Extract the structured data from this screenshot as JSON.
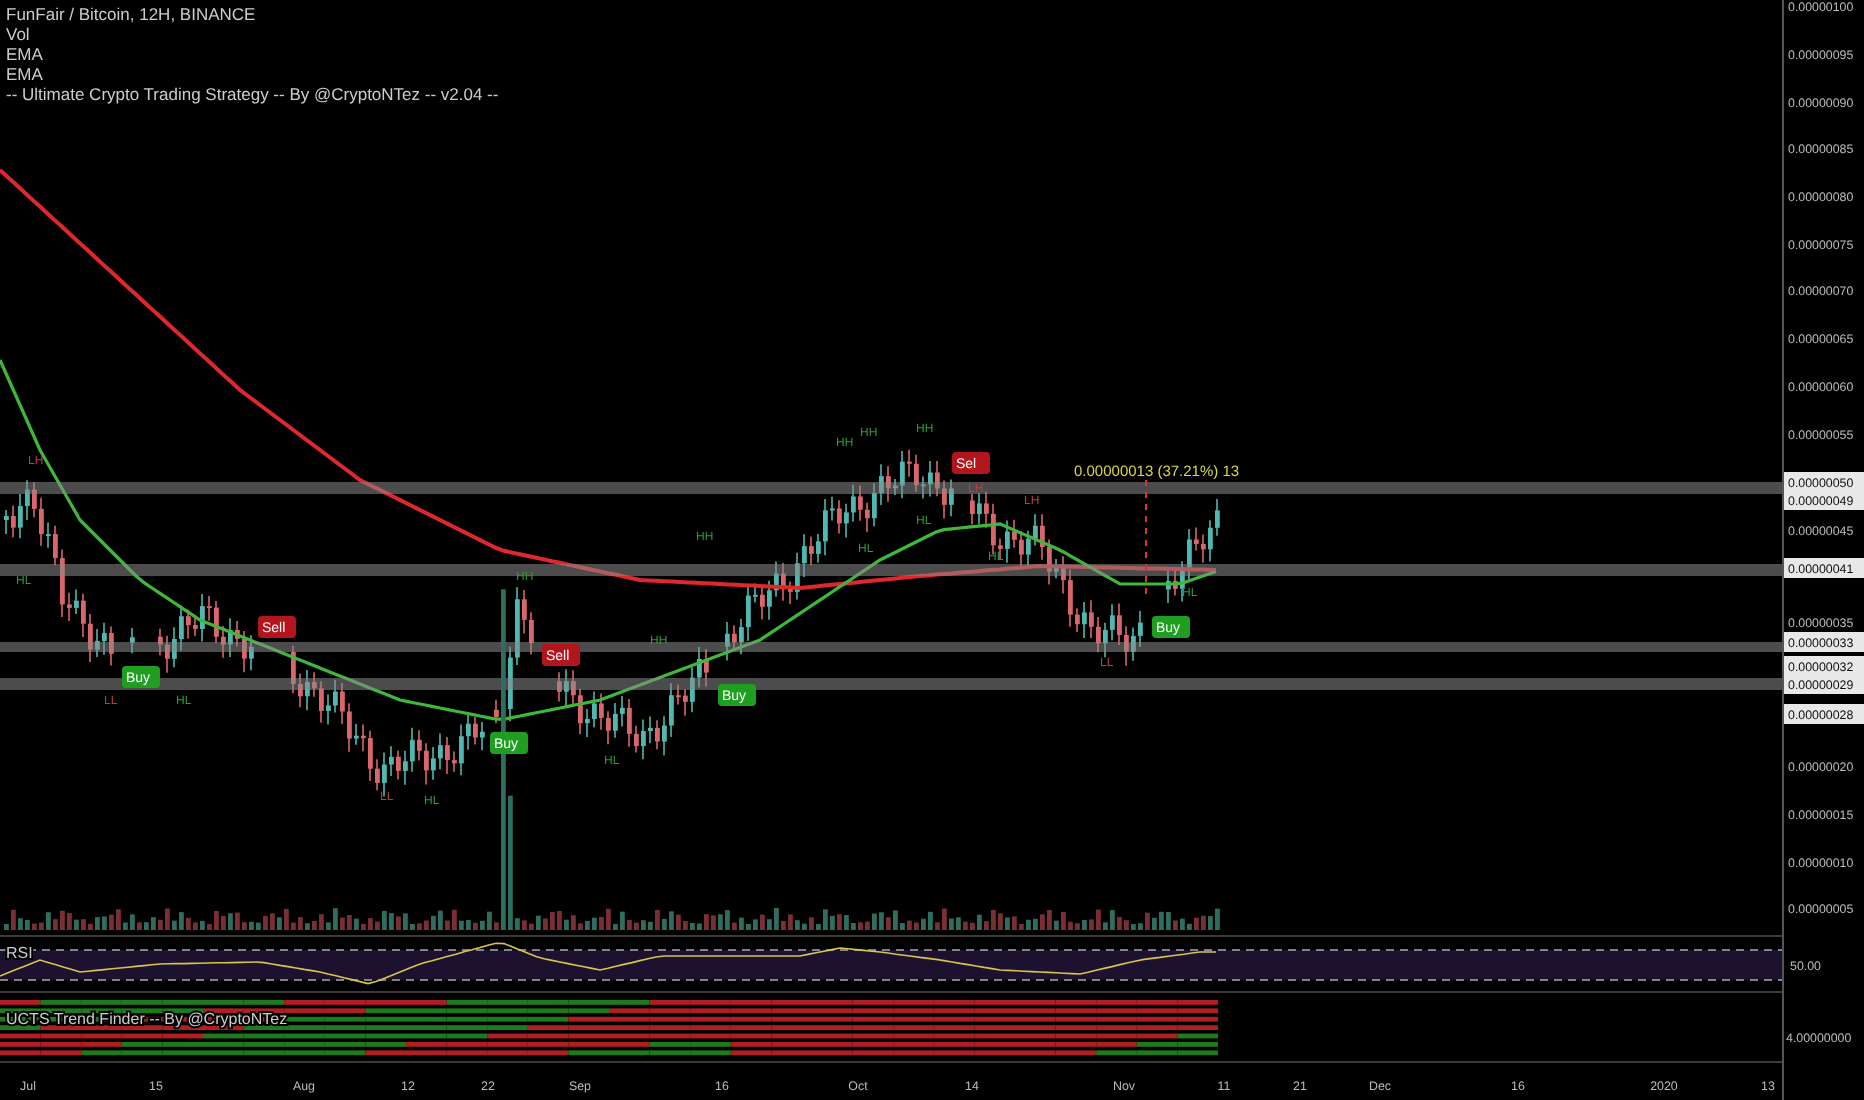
{
  "header": {
    "symbol": "FunFair / Bitcoin, 12H, BINANCE",
    "indicators": [
      "Vol",
      "EMA",
      "EMA",
      "-- Ultimate Crypto Trading Strategy -- By @CryptoNTez -- v2.04 --"
    ]
  },
  "chart": {
    "measure": "0.00000013 (37.21%) 13",
    "signals": [
      {
        "label": "Buy",
        "kind": "buy"
      },
      {
        "label": "Sell",
        "kind": "sell"
      },
      {
        "label": "Buy",
        "kind": "buy"
      },
      {
        "label": "Sell",
        "kind": "sell"
      },
      {
        "label": "Buy",
        "kind": "buy"
      },
      {
        "label": "Sel",
        "kind": "sell"
      },
      {
        "label": "Buy",
        "kind": "buy"
      }
    ],
    "pivots": [
      {
        "label": "LH",
        "kind": "low"
      },
      {
        "label": "HL",
        "kind": "high"
      },
      {
        "label": "LL",
        "kind": "low"
      },
      {
        "label": "HL",
        "kind": "high"
      },
      {
        "label": "LL",
        "kind": "low"
      },
      {
        "label": "HL",
        "kind": "high"
      },
      {
        "label": "HH",
        "kind": "high"
      },
      {
        "label": "HL",
        "kind": "high"
      },
      {
        "label": "HH",
        "kind": "high"
      },
      {
        "label": "HH",
        "kind": "high"
      },
      {
        "label": "HH",
        "kind": "high"
      },
      {
        "label": "HH",
        "kind": "high"
      },
      {
        "label": "HH",
        "kind": "high"
      },
      {
        "label": "HL",
        "kind": "high"
      },
      {
        "label": "HL",
        "kind": "high"
      },
      {
        "label": "LH",
        "kind": "low"
      },
      {
        "label": "HL",
        "kind": "high"
      },
      {
        "label": "LH",
        "kind": "low"
      },
      {
        "label": "LL",
        "kind": "low"
      },
      {
        "label": "HL",
        "kind": "high"
      }
    ]
  },
  "price_axis": [
    {
      "label": "0.00000100",
      "kind": "tick"
    },
    {
      "label": "0.00000095",
      "kind": "tick"
    },
    {
      "label": "0.00000090",
      "kind": "tick"
    },
    {
      "label": "0.00000085",
      "kind": "tick"
    },
    {
      "label": "0.00000080",
      "kind": "tick"
    },
    {
      "label": "0.00000075",
      "kind": "tick"
    },
    {
      "label": "0.00000070",
      "kind": "tick"
    },
    {
      "label": "0.00000065",
      "kind": "tick"
    },
    {
      "label": "0.00000060",
      "kind": "tick"
    },
    {
      "label": "0.00000055",
      "kind": "tick"
    },
    {
      "label": "0.00000050",
      "kind": "highlight"
    },
    {
      "label": "0.00000049",
      "kind": "highlight"
    },
    {
      "label": "0.00000045",
      "kind": "tick"
    },
    {
      "label": "0.00000041",
      "kind": "highlight"
    },
    {
      "label": "0.00000035",
      "kind": "tick"
    },
    {
      "label": "0.00000033",
      "kind": "highlight"
    },
    {
      "label": "0.00000032",
      "kind": "highlight"
    },
    {
      "label": "0.00000029",
      "kind": "highlight"
    },
    {
      "label": "0.00000028",
      "kind": "highlight"
    },
    {
      "label": "0.00000020",
      "kind": "tick"
    },
    {
      "label": "0.00000015",
      "kind": "tick"
    },
    {
      "label": "0.00000010",
      "kind": "tick"
    },
    {
      "label": "0.00000005",
      "kind": "tick"
    }
  ],
  "rsi": {
    "title": "RSI",
    "axis_label": "50.00"
  },
  "trend_finder": {
    "title": "UCTS Trend Finder -- By @CryptoNTez",
    "axis_label": "4.00000000"
  },
  "time_axis": [
    "Jul",
    "15",
    "Aug",
    "12",
    "22",
    "Sep",
    "16",
    "Oct",
    "14",
    "Nov",
    "11",
    "21",
    "Dec",
    "16",
    "2020",
    "13"
  ]
}
